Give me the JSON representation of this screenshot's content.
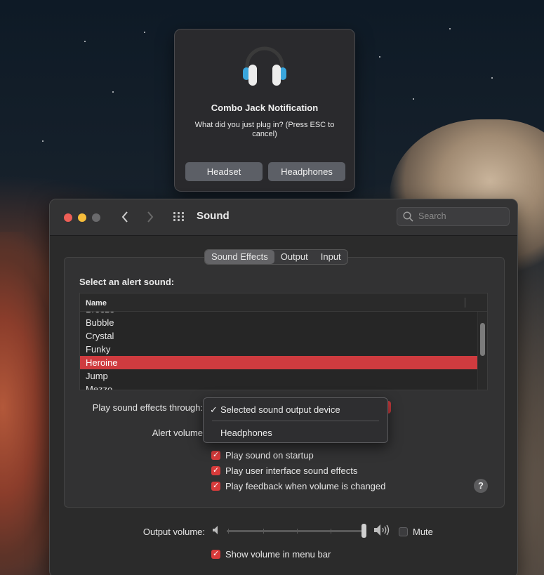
{
  "notification": {
    "title": "Combo Jack Notification",
    "message": "What did you just plug in? (Press ESC to cancel)",
    "buttons": [
      "Headset",
      "Headphones"
    ],
    "icon": "headphones-icon"
  },
  "window": {
    "title": "Sound",
    "search_placeholder": "Search",
    "tabs": [
      {
        "label": "Sound Effects",
        "active": true
      },
      {
        "label": "Output",
        "active": false
      },
      {
        "label": "Input",
        "active": false
      }
    ]
  },
  "alert_list": {
    "label": "Select an alert sound:",
    "column_header": "Name",
    "items": [
      "Breeze",
      "Bubble",
      "Crystal",
      "Funky",
      "Heroine",
      "Jump",
      "Mezzo"
    ],
    "selected": "Heroine"
  },
  "play_through": {
    "label": "Play sound effects through:",
    "options": [
      "Selected sound output device",
      "Headphones"
    ],
    "selected": "Selected sound output device"
  },
  "alert_volume": {
    "label": "Alert volume"
  },
  "checkboxes": [
    {
      "label": "Play sound on startup",
      "checked": true
    },
    {
      "label": "Play user interface sound effects",
      "checked": true
    },
    {
      "label": "Play feedback when volume is changed",
      "checked": true
    }
  ],
  "help_label": "?",
  "output_volume": {
    "label": "Output volume:",
    "level": 1.0,
    "mute_label": "Mute",
    "muted": false
  },
  "show_volume": {
    "label": "Show volume in menu bar",
    "checked": true
  },
  "colors": {
    "accent": "#d83b3b",
    "selection": "#cf3b3f"
  }
}
